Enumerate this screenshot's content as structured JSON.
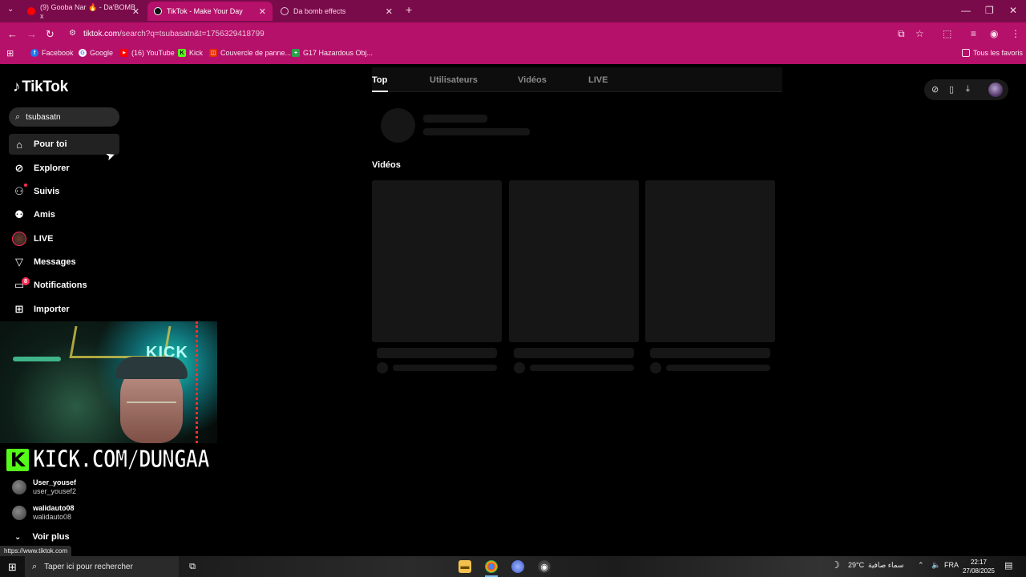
{
  "browser": {
    "tabs": [
      {
        "title": "(9) Gooba Nar 🔥 - Da'BOMB x",
        "icon_color": "#ff0000"
      },
      {
        "title": "TikTok - Make Your Day",
        "icon_color": "#000000"
      },
      {
        "title": "Da bomb effects",
        "icon_color": "#cfcfcf"
      }
    ],
    "new_tab": "+",
    "url_host": "tiktok.com",
    "url_rest": "/search?q=tsubasatn&t=1756329418799",
    "bookmarks": [
      {
        "label": "Facebook",
        "icon": "facebook-icon",
        "color": "#1877f2",
        "glyph": "f"
      },
      {
        "label": "Google",
        "icon": "google-icon",
        "color": "#4285f4",
        "glyph": "G"
      },
      {
        "label": "(16) YouTube",
        "icon": "youtube-icon",
        "color": "#ff0000",
        "glyph": "▶"
      },
      {
        "label": "Kick",
        "icon": "kick-icon",
        "color": "#53fc18",
        "glyph": "K"
      },
      {
        "label": "Couvercle de panne...",
        "icon": "aliexpress-icon",
        "color": "#e62e04",
        "glyph": "◫"
      },
      {
        "label": "G17 Hazardous Obj...",
        "icon": "plus-cross-icon",
        "color": "#2aa34a",
        "glyph": "+"
      }
    ],
    "all_bookmarks": "Tous les favoris",
    "status_url": "https://www.tiktok.com"
  },
  "sidebar": {
    "logo": "TikTok",
    "search_value": "tsubasatn",
    "nav": [
      {
        "label": "Pour toi",
        "icon": "home-icon",
        "glyph": "⌂"
      },
      {
        "label": "Explorer",
        "icon": "compass-icon",
        "glyph": "⊘"
      },
      {
        "label": "Suivis",
        "icon": "user-follow-icon",
        "glyph": "⚇"
      },
      {
        "label": "Amis",
        "icon": "friends-icon",
        "glyph": "⚉"
      },
      {
        "label": "LIVE",
        "icon": "live-avatar-icon",
        "glyph": "●"
      },
      {
        "label": "Messages",
        "icon": "send-icon",
        "glyph": "▽"
      },
      {
        "label": "Notifications",
        "icon": "notifications-icon",
        "glyph": "▭"
      },
      {
        "label": "Importer",
        "icon": "upload-icon",
        "glyph": "⊞"
      }
    ],
    "notifications_badge": "8",
    "kick_letter": "K",
    "kick_text": "KICK.COM/DUNGAA",
    "webcam_sign": "KICK",
    "following": [
      {
        "name": "User_yousef",
        "handle": "user_yousef2"
      },
      {
        "name": "walidauto08",
        "handle": "walidauto08"
      }
    ],
    "see_more": "Voir plus"
  },
  "main": {
    "tabs": [
      "Top",
      "Utilisateurs",
      "Vidéos",
      "LIVE"
    ],
    "section_title": "Vidéos"
  },
  "taskbar": {
    "search_placeholder": "Taper ici pour rechercher",
    "weather": "29°C",
    "weather_desc": "سماء صافية",
    "lang": "FRA",
    "time": "22:17",
    "date": "27/08/2025"
  },
  "colors": {
    "chrome_tab_bar": "#7a0b4a",
    "chrome_toolbar": "#b5106a",
    "tiktok_red": "#fe2c55",
    "kick_green": "#53fc18"
  }
}
